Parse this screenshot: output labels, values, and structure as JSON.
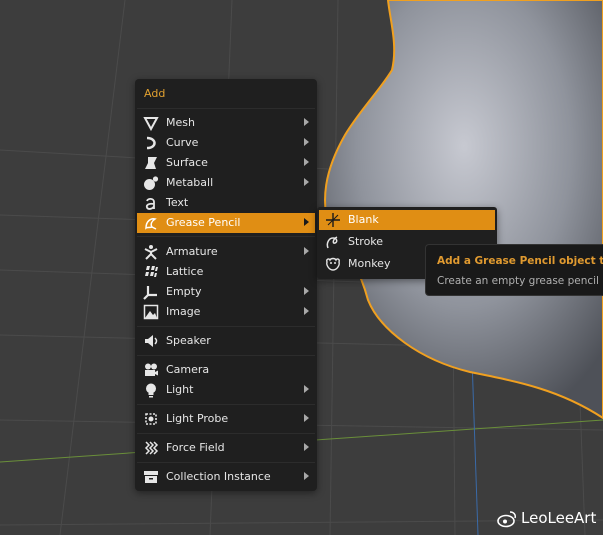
{
  "menu": {
    "title": "Add",
    "items": [
      {
        "label": "Mesh",
        "icon": "mesh-icon",
        "submenu": true
      },
      {
        "label": "Curve",
        "icon": "curve-icon",
        "submenu": true
      },
      {
        "label": "Surface",
        "icon": "surface-icon",
        "submenu": true
      },
      {
        "label": "Metaball",
        "icon": "metaball-icon",
        "submenu": true
      },
      {
        "label": "Text",
        "icon": "text-icon",
        "submenu": false
      },
      {
        "label": "Grease Pencil",
        "icon": "grease-pencil-icon",
        "submenu": true,
        "active": true
      },
      {
        "label": "Armature",
        "icon": "armature-icon",
        "submenu": true
      },
      {
        "label": "Lattice",
        "icon": "lattice-icon",
        "submenu": false
      },
      {
        "label": "Empty",
        "icon": "empty-icon",
        "submenu": true
      },
      {
        "label": "Image",
        "icon": "image-icon",
        "submenu": true
      },
      {
        "label": "Speaker",
        "icon": "speaker-icon",
        "submenu": false
      },
      {
        "label": "Camera",
        "icon": "camera-icon",
        "submenu": false
      },
      {
        "label": "Light",
        "icon": "light-icon",
        "submenu": true
      },
      {
        "label": "Light Probe",
        "icon": "light-probe-icon",
        "submenu": true
      },
      {
        "label": "Force Field",
        "icon": "force-field-icon",
        "submenu": true
      },
      {
        "label": "Collection Instance",
        "icon": "collection-instance-icon",
        "submenu": true
      }
    ]
  },
  "submenu": {
    "items": [
      {
        "label": "Blank",
        "icon": "blank-icon",
        "active": true
      },
      {
        "label": "Stroke",
        "icon": "stroke-icon"
      },
      {
        "label": "Monkey",
        "icon": "monkey-icon"
      }
    ]
  },
  "tooltip": {
    "title": "Add a Grease Pencil object to the",
    "body": "Create an empty grease pencil ob"
  },
  "watermark": {
    "text": "LeoLeeArt",
    "icon": "weibo-icon"
  },
  "colors": {
    "accent": "#e08e14",
    "menu_bg": "#1f1f1f",
    "outline": "#f0a020",
    "viewport_bg": "#3d3d3d"
  }
}
